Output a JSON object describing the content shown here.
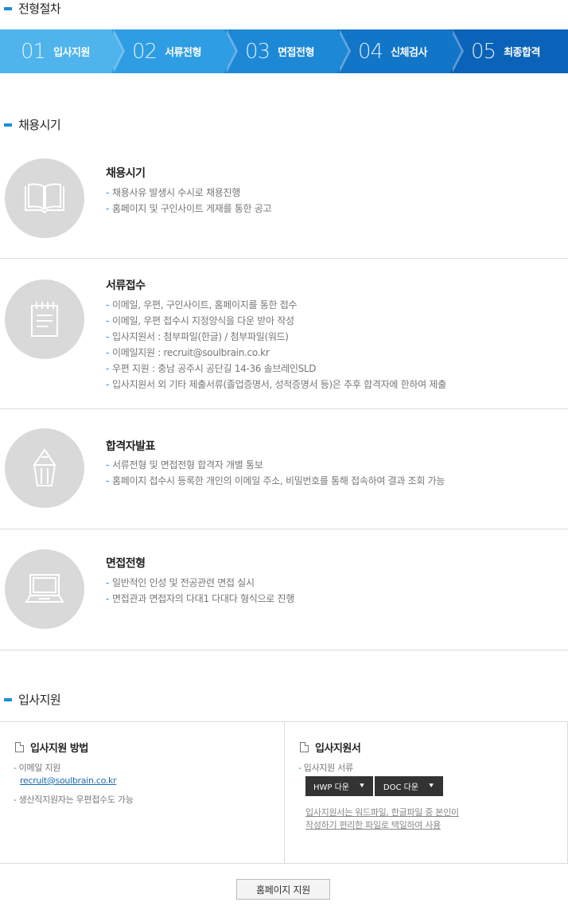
{
  "sections": {
    "process_title": "전형절차",
    "timing_title": "채용시기",
    "apply_title": "입사지원"
  },
  "steps": [
    {
      "num": "01",
      "label": "입사지원",
      "color": "#4fb3ec"
    },
    {
      "num": "02",
      "label": "서류전형",
      "color": "#2f9de4"
    },
    {
      "num": "03",
      "label": "면접전형",
      "color": "#1d88d6"
    },
    {
      "num": "04",
      "label": "신체검사",
      "color": "#1276c8"
    },
    {
      "num": "05",
      "label": "최종합격",
      "color": "#0a63b9"
    }
  ],
  "items": [
    {
      "icon": "book-icon",
      "title": "채용시기",
      "lines": [
        "채용사유 발생시 수시로 채용진행",
        "홈페이지 및 구인사이트 게재를 통한 공고"
      ]
    },
    {
      "icon": "notepad-icon",
      "title": "서류접수",
      "lines": [
        "이메일, 우편, 구인사이트, 홈페이지를 통한 접수",
        "이메일, 우편 접수시 지정양식을 다운 받아 작성",
        "입사지원서 : 첨부파일(한글) / 첨부파일(워드)",
        "이메일지원 : recruit@soulbrain.co.kr",
        "우편 지원 : 충남 공주시 공단길 14-36 솔브레인SLD",
        "입사지원서 외 기타 제출서류(졸업증명서, 성적증명서 등)은 추후 합격자에 한하여 제출"
      ]
    },
    {
      "icon": "pencil-icon",
      "title": "합격자발표",
      "lines": [
        "서류전형 및 면접전형 합격자 개별 통보",
        "홈페이지 접수시 등록한 개인의 이메일 주소, 비밀번호를 통해 접속하여 결과 조회 가능"
      ]
    },
    {
      "icon": "computer-icon",
      "title": "면접전형",
      "lines": [
        "일반적인 인성 및 전공관련 면접 실시",
        "면접관과 면접자의 다대1 다대다 형식으로 진행"
      ]
    }
  ],
  "apply": {
    "method": {
      "title": "입사지원 방법",
      "email_label": "이메일 지원",
      "email": "recruit@soulbrain.co.kr",
      "post_note": "생산직지원자는 우편접수도 가능"
    },
    "form": {
      "title": "입사지원서",
      "docs_label": "입사지원 서류",
      "hwp_label": "HWP 다운",
      "doc_label": "DOC 다운",
      "note_line1": "입사지원서는 워드파일, 한글파일 중 본인이",
      "note_line2": "작성하기 편리한 파일로 택일하여 사용"
    }
  },
  "home_button": "홈페이지 지원"
}
